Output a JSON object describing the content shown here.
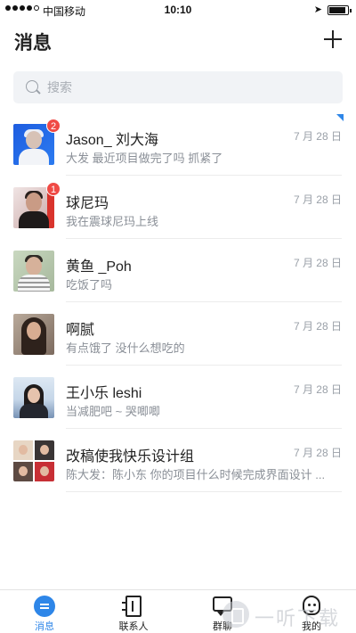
{
  "status_bar": {
    "carrier": "中国移动",
    "time": "10:10"
  },
  "header": {
    "title": "消息"
  },
  "search": {
    "placeholder": "搜索"
  },
  "conversations": [
    {
      "name": "Jason_ 刘大海",
      "preview": "大发 最近项目做完了吗 抓紧了",
      "date": "7 月 28 日",
      "badge": "2"
    },
    {
      "name": "球尼玛",
      "preview": "我在震球尼玛上线",
      "date": "7 月 28 日",
      "badge": "1"
    },
    {
      "name": "黄鱼 _Poh",
      "preview": "吃饭了吗",
      "date": "7 月 28 日"
    },
    {
      "name": "啊腻",
      "preview": "有点饿了 没什么想吃的",
      "date": "7 月 28 日"
    },
    {
      "name": "王小乐 leshi",
      "preview": "当减肥吧 ~ 哭唧唧",
      "date": "7 月 28 日"
    },
    {
      "name": "改稿使我快乐设计组",
      "preview": "陈大发：陈小东 你的项目什么时候完成界面设计 ...",
      "date": "7 月 28 日"
    }
  ],
  "tabbar": {
    "tabs": [
      {
        "label": "消息",
        "icon": "message-icon",
        "active": true
      },
      {
        "label": "联系人",
        "icon": "contacts-icon"
      },
      {
        "label": "群聊",
        "icon": "group-chat-icon"
      },
      {
        "label": "我的",
        "icon": "profile-icon"
      }
    ]
  },
  "watermark": {
    "text": "一听下载"
  },
  "colors": {
    "accent": "#2e86e8",
    "badge": "#f04a45",
    "preview_text": "#8a8f97",
    "search_bg": "#f1f3f6"
  }
}
